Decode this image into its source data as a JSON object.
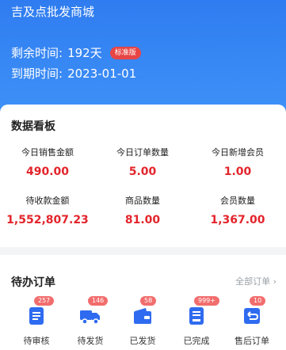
{
  "hero": {
    "topright_text": "",
    "store_name": "吉及点批发商城",
    "remaining_label": "剩余时间:",
    "remaining_value": "192天",
    "edition_badge": "标准版",
    "expiry_label": "到期时间:",
    "expiry_value": "2023-01-01",
    "colors": {
      "bg": "#2f7cf0",
      "badge": "#e84545"
    }
  },
  "dashboard": {
    "title": "数据看板",
    "metrics": [
      {
        "label": "今日销售金额",
        "value": "490.00"
      },
      {
        "label": "今日订单数量",
        "value": "5.00"
      },
      {
        "label": "今日新增会员",
        "value": "1.00"
      },
      {
        "label": "待收款金额",
        "value": "1,552,807.23"
      },
      {
        "label": "商品数量",
        "value": "81.00"
      },
      {
        "label": "会员数量",
        "value": "1,367.00"
      }
    ],
    "value_color": "#e3242b"
  },
  "pending_orders": {
    "title": "待办订单",
    "all_orders_label": "全部订单 ›",
    "items": [
      {
        "label": "待审核",
        "count": "257",
        "icon": "document-list-icon"
      },
      {
        "label": "待发货",
        "count": "146",
        "icon": "delivery-truck-icon"
      },
      {
        "label": "已发货",
        "count": "58",
        "icon": "wallet-icon"
      },
      {
        "label": "已完成",
        "count": "999+",
        "icon": "completed-document-icon"
      },
      {
        "label": "售后订单",
        "count": "10",
        "icon": "return-icon"
      }
    ],
    "icon_color": "#2f6bf0",
    "badge_color": "#f26d6d"
  }
}
